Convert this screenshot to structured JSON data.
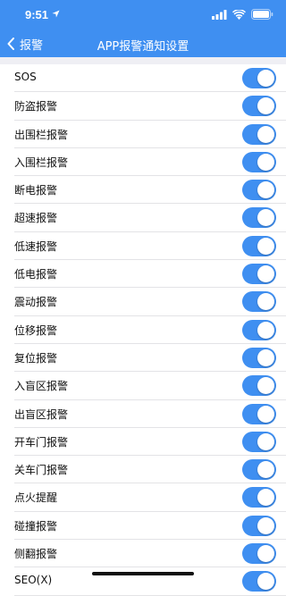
{
  "status_bar": {
    "time": "9:51",
    "icons": [
      "location-arrow-icon",
      "cellular-signal-icon",
      "wifi-icon",
      "battery-icon"
    ]
  },
  "nav": {
    "back_label": "报警",
    "title": "APP报警通知设置"
  },
  "colors": {
    "accent": "#3f8ff1",
    "background": "#efeff4",
    "divider": "#e3e3e6"
  },
  "settings": [
    {
      "label": "SOS",
      "enabled": true
    },
    {
      "label": "防盗报警",
      "enabled": true
    },
    {
      "label": "出围栏报警",
      "enabled": true
    },
    {
      "label": "入围栏报警",
      "enabled": true
    },
    {
      "label": "断电报警",
      "enabled": true
    },
    {
      "label": "超速报警",
      "enabled": true
    },
    {
      "label": "低速报警",
      "enabled": true
    },
    {
      "label": "低电报警",
      "enabled": true
    },
    {
      "label": "震动报警",
      "enabled": true
    },
    {
      "label": "位移报警",
      "enabled": true
    },
    {
      "label": "复位报警",
      "enabled": true
    },
    {
      "label": "入盲区报警",
      "enabled": true
    },
    {
      "label": "出盲区报警",
      "enabled": true
    },
    {
      "label": "开车门报警",
      "enabled": true
    },
    {
      "label": "关车门报警",
      "enabled": true
    },
    {
      "label": "点火提醒",
      "enabled": true
    },
    {
      "label": "碰撞报警",
      "enabled": true
    },
    {
      "label": "侧翻报警",
      "enabled": true
    },
    {
      "label": "SEO(X)",
      "enabled": true
    }
  ]
}
